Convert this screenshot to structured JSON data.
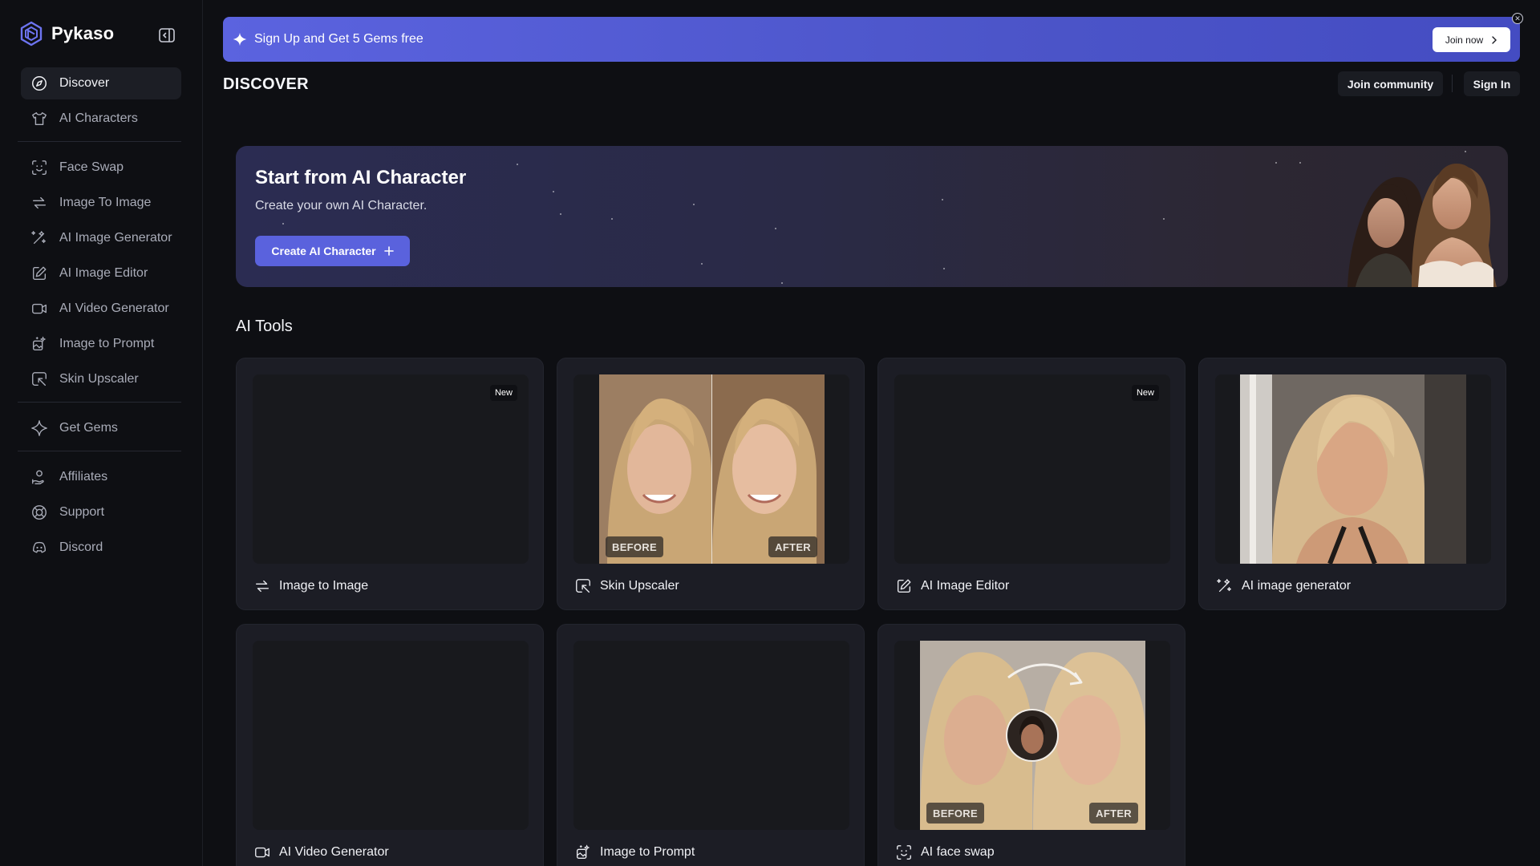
{
  "brand": {
    "name": "Pykaso"
  },
  "sidebar": {
    "groups": [
      [
        {
          "label": "Discover",
          "icon": "compass-icon",
          "active": true
        },
        {
          "label": "AI Characters",
          "icon": "shirt-icon"
        }
      ],
      [
        {
          "label": "Face Swap",
          "icon": "face-scan-icon"
        },
        {
          "label": "Image To Image",
          "icon": "arrows-swap-icon"
        },
        {
          "label": "AI Image Generator",
          "icon": "magic-wand-icon"
        },
        {
          "label": "AI Image Editor",
          "icon": "edit-square-icon"
        },
        {
          "label": "AI Video Generator",
          "icon": "video-camera-icon"
        },
        {
          "label": "Image to Prompt",
          "icon": "image-sparkle-icon"
        },
        {
          "label": "Skin Upscaler",
          "icon": "upscale-icon"
        }
      ],
      [
        {
          "label": "Get Gems",
          "icon": "sparkle-icon"
        }
      ],
      [
        {
          "label": "Affiliates",
          "icon": "affiliate-icon"
        },
        {
          "label": "Support",
          "icon": "lifebuoy-icon"
        },
        {
          "label": "Discord",
          "icon": "discord-icon"
        }
      ]
    ]
  },
  "promo": {
    "text": "Sign Up and Get 5 Gems free",
    "cta": "Join now"
  },
  "header": {
    "title": "DISCOVER",
    "join_community": "Join community",
    "sign_in": "Sign In"
  },
  "hero": {
    "title": "Start from AI Character",
    "subtitle": "Create your own AI Character.",
    "cta": "Create AI Character"
  },
  "tools": {
    "title": "AI Tools",
    "items": [
      {
        "label": "Image to Image",
        "icon": "arrows-swap-icon",
        "badge": "New"
      },
      {
        "label": "Skin Upscaler",
        "icon": "upscale-icon",
        "before": "BEFORE",
        "after": "AFTER"
      },
      {
        "label": "AI Image Editor",
        "icon": "edit-square-icon",
        "badge": "New"
      },
      {
        "label": "AI image generator",
        "icon": "magic-wand-icon"
      },
      {
        "label": "AI Video Generator",
        "icon": "video-camera-icon"
      },
      {
        "label": "Image to Prompt",
        "icon": "image-sparkle-icon"
      },
      {
        "label": "AI face swap",
        "icon": "face-scan-icon",
        "before": "BEFORE",
        "after": "AFTER"
      }
    ]
  },
  "colors": {
    "accent": "#5a62dd",
    "background": "#0e0f13",
    "card": "#1c1d25"
  }
}
